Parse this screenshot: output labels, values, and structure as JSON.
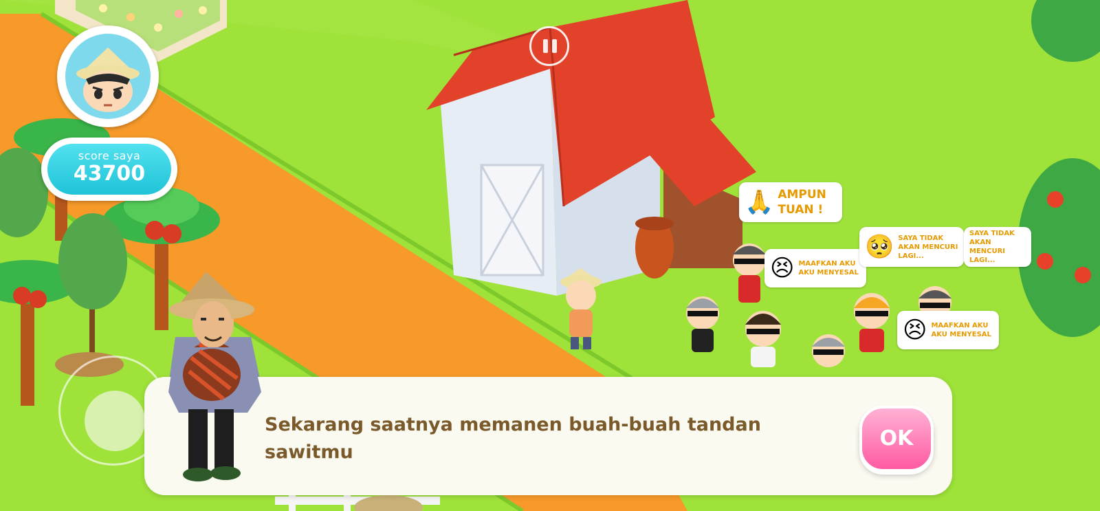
{
  "hud": {
    "score_label": "score saya",
    "score_value": "43700"
  },
  "dialog": {
    "text": "Sekarang saatnya memanen buah-buah tandan sawitmu",
    "ok_label": "OK"
  },
  "bubbles": [
    {
      "emoji": "🙏",
      "text": "AMPUN\nTUAN !"
    },
    {
      "emoji": "😣",
      "text": "MAAFKAN AKU\nAKU MENYESAL"
    },
    {
      "emoji": "🥺",
      "text": "SAYA TIDAK\nAKAN MENCURI\nLAGI..."
    },
    {
      "text": "SAYA TIDAK\nAKAN MENCURI\nLAGI..."
    },
    {
      "emoji": "😣",
      "text": "MAAFKAN AKU\nAKU MENYESAL"
    }
  ],
  "colors": {
    "grass": "#9ee23a",
    "path": "#f79a2a",
    "roof": "#e2422a",
    "score_pill": "#1fc3d8",
    "ok_button": "#ff5aa2",
    "dialog_text": "#7a5a2a",
    "bubble_text": "#e69a00"
  }
}
